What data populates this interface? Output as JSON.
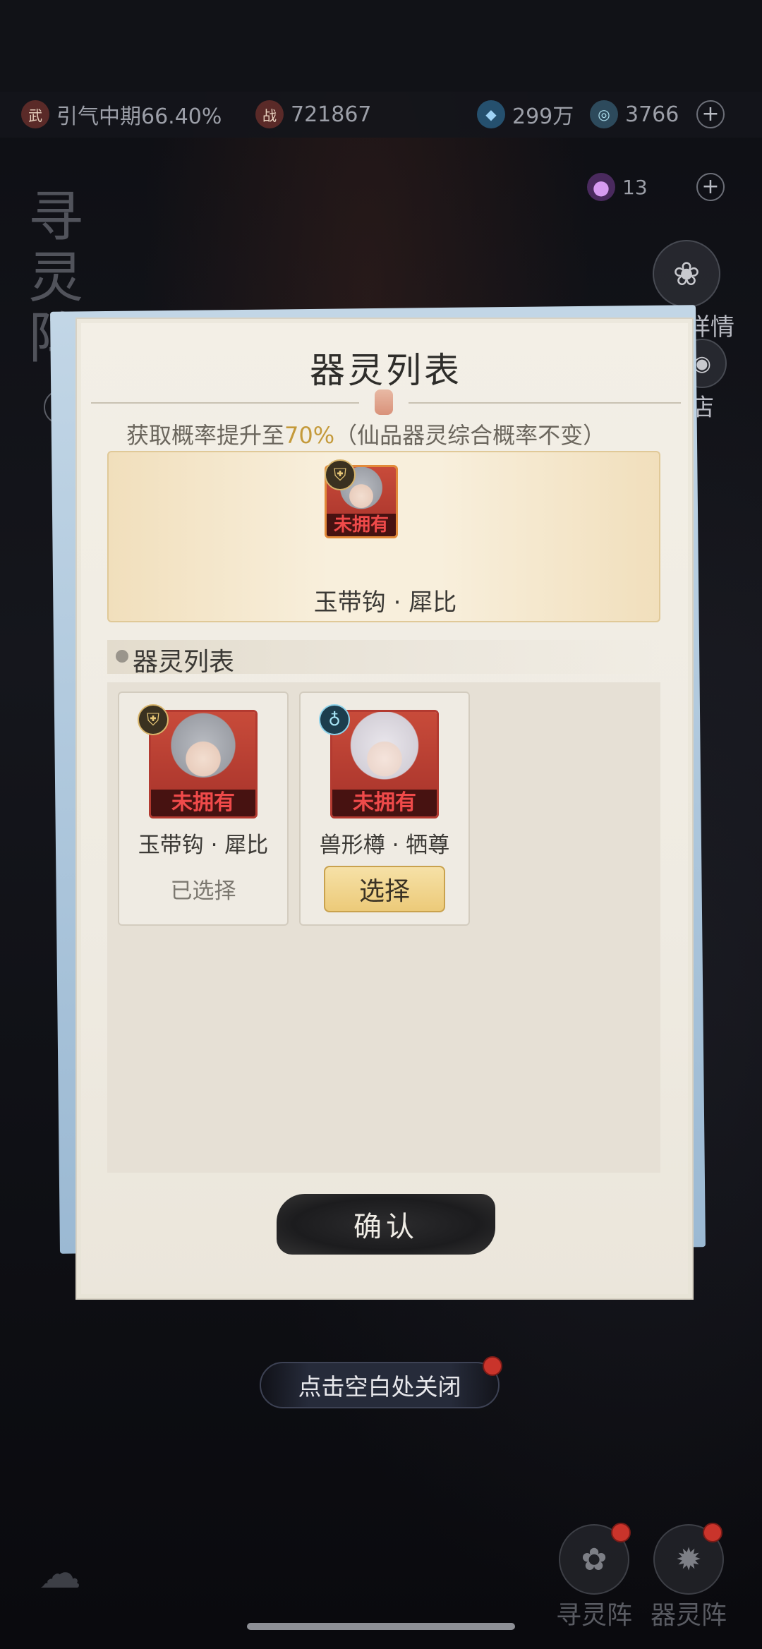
{
  "resources": {
    "realm": "引气中期66.40%",
    "power": "721867",
    "stones": "299万",
    "jade": "3766",
    "gems": "13"
  },
  "side": {
    "left_title": "寻灵阵",
    "reward_details": "奖励详情",
    "shop": "店",
    "help": "?"
  },
  "dialog": {
    "title": "器灵列表",
    "probability_prefix": "获取概率提升至",
    "probability_value": "70%",
    "probability_suffix": "（仙品器灵综合概率不变）",
    "featured": {
      "name": "玉带钩 · 犀比",
      "status_tag": "未拥有"
    },
    "section_title": "器灵列表",
    "cards": [
      {
        "name": "玉带钩 · 犀比",
        "tag": "未拥有",
        "status": "已选择"
      },
      {
        "name": "兽形樽 · 牺尊",
        "tag": "未拥有",
        "button": "选择"
      }
    ],
    "confirm": "确认"
  },
  "close_hint": "点击空白处关闭",
  "bottom_nav": {
    "seek_array": "寻灵阵",
    "spirit_array": "器灵阵"
  },
  "colors": {
    "highlight": "#c49a3b",
    "not_owned_tag": "#ef4a4a"
  }
}
